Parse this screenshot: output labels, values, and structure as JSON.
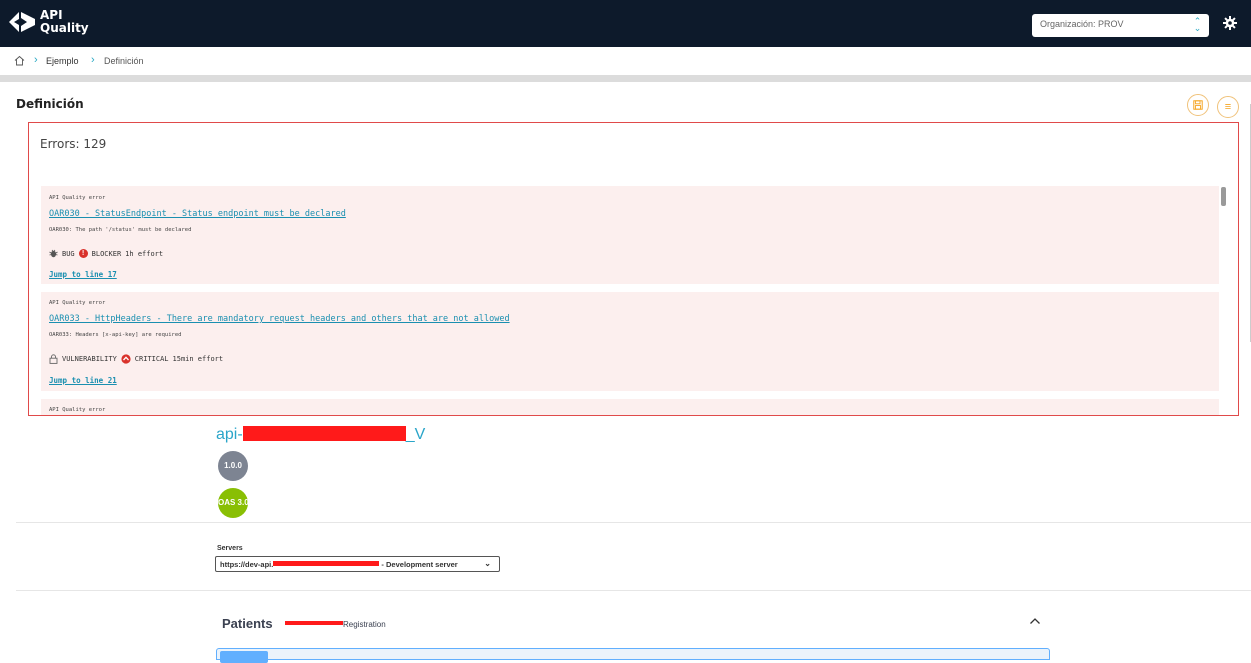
{
  "app": {
    "brand_line1": "API",
    "brand_line2": "Quality",
    "org_select_value": "Organización: PROV"
  },
  "breadcrumb": {
    "items": [
      "Ejemplo",
      "Definición"
    ]
  },
  "section": {
    "title": "Definición"
  },
  "errors_panel": {
    "count_label": "Errors: 129",
    "items": [
      {
        "type": "API Quality error",
        "title": "OAR030 - StatusEndpoint - Status endpoint must be declared",
        "description": "OAR030: The path '/status' must be declared",
        "kind": "BUG",
        "severity": "BLOCKER",
        "effort": "1h effort",
        "jump": "Jump to line 17"
      },
      {
        "type": "API Quality error",
        "title": "OAR033 - HttpHeaders - There are mandatory request headers and others that are not allowed",
        "description": "OAR033: Headers [x-api-key] are required",
        "kind": "VULNERABILITY",
        "severity": "CRITICAL",
        "effort": "15min effort",
        "jump": "Jump to line 21"
      },
      {
        "type": "API Quality error"
      }
    ]
  },
  "swagger": {
    "api_title_prefix": "api-",
    "api_title_suffix": "_V",
    "version": "1.0.0",
    "oas": "OAS 3.0",
    "servers_label": "Servers",
    "server_prefix": "https://dev-api.",
    "server_suffix": " - Development server",
    "tag_name": "Patients",
    "tag_description_suffix": "Registration"
  },
  "colors": {
    "topbar": "#0d1a2b",
    "accent": "#29a9c4",
    "error_border": "#e04a4a",
    "error_bg": "#fcefee",
    "oas_green": "#89bf04",
    "version_gray": "#7d8492",
    "redaction": "#ff1a1a"
  }
}
